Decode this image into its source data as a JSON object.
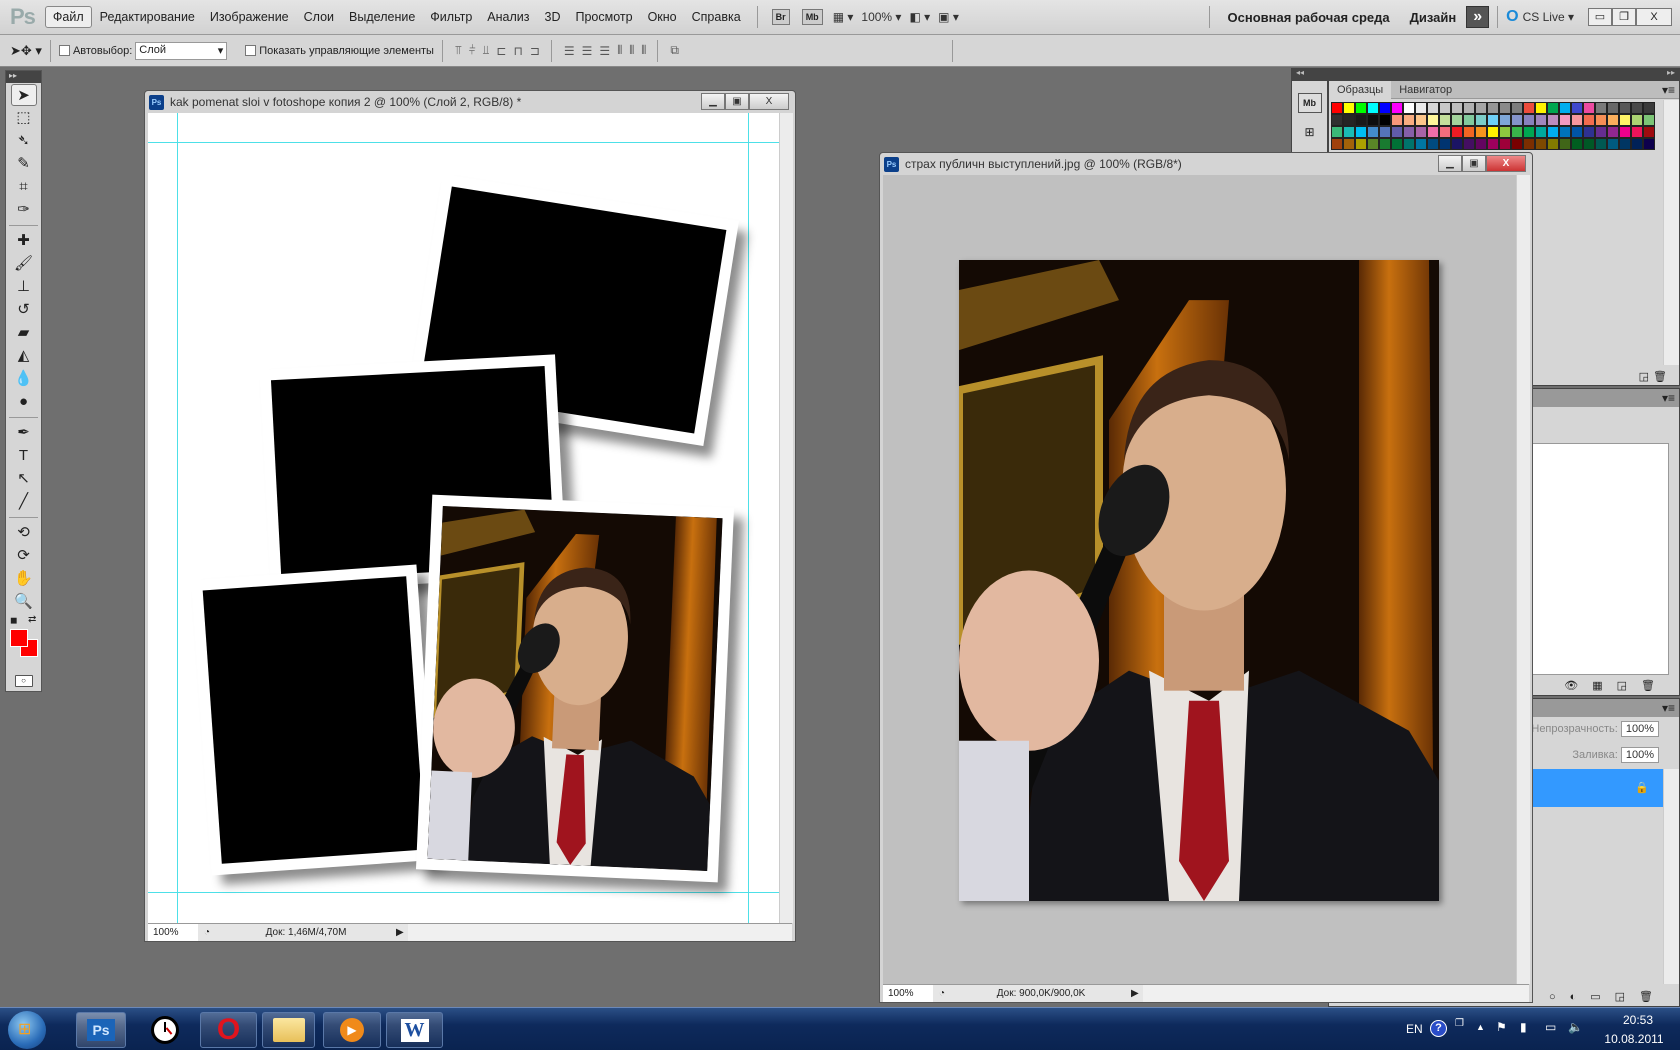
{
  "menubar": {
    "logo": "Ps",
    "items": [
      "Файл",
      "Редактирование",
      "Изображение",
      "Слои",
      "Выделение",
      "Фильтр",
      "Анализ",
      "3D",
      "Просмотр",
      "Окно",
      "Справка"
    ],
    "bridge": "Br",
    "minibridge": "Mb",
    "zoom": "100%",
    "workspace": "Основная рабочая среда",
    "design": "Дизайн",
    "more": "»",
    "cslive": "CS Live ▾",
    "win_min": "▭",
    "win_restore": "❐",
    "win_close": "X"
  },
  "options": {
    "auto_select_label": "Автовыбор:",
    "auto_select_value": "Слой",
    "show_controls_label": "Показать управляющие элементы"
  },
  "toolbar": {
    "tools": [
      {
        "name": "move-tool-icon",
        "glyph": "➤"
      },
      {
        "name": "marquee-tool-icon",
        "glyph": "⬚"
      },
      {
        "name": "lasso-tool-icon",
        "glyph": "➴"
      },
      {
        "name": "quick-select-tool-icon",
        "glyph": "✎"
      },
      {
        "name": "crop-tool-icon",
        "glyph": "⌗"
      },
      {
        "name": "eyedropper-tool-icon",
        "glyph": "✑"
      },
      {
        "sep": true
      },
      {
        "name": "healing-brush-icon",
        "glyph": "✚"
      },
      {
        "name": "brush-tool-icon",
        "glyph": "🖌"
      },
      {
        "name": "stamp-tool-icon",
        "glyph": "⊥"
      },
      {
        "name": "history-brush-icon",
        "glyph": "↺"
      },
      {
        "name": "eraser-tool-icon",
        "glyph": "▰"
      },
      {
        "name": "paint-bucket-icon",
        "glyph": "◭"
      },
      {
        "name": "blur-tool-icon",
        "glyph": "💧"
      },
      {
        "name": "dodge-tool-icon",
        "glyph": "●"
      },
      {
        "sep": true
      },
      {
        "name": "pen-tool-icon",
        "glyph": "✒"
      },
      {
        "name": "type-tool-icon",
        "glyph": "T"
      },
      {
        "name": "path-select-icon",
        "glyph": "↖"
      },
      {
        "name": "line-tool-icon",
        "glyph": "╱"
      },
      {
        "sep": true
      },
      {
        "name": "3d-rotate-icon",
        "glyph": "⟲"
      },
      {
        "name": "3d-orbit-icon",
        "glyph": "⟳"
      },
      {
        "name": "hand-tool-icon",
        "glyph": "✋"
      },
      {
        "name": "zoom-tool-icon",
        "glyph": "🔍"
      }
    ],
    "foreground": "#ff0000",
    "background": "#ff0000"
  },
  "doc1": {
    "title": "kak pomenat sloi v fotoshope копия 2 @ 100% (Слой 2, RGB/8) *",
    "zoom": "100%",
    "info": "Док: 1,46M/4,70M"
  },
  "doc2": {
    "title": "страх публичн выступлений.jpg @ 100% (RGB/8*)",
    "zoom": "100%",
    "info": "Док: 900,0K/900,0K"
  },
  "panels": {
    "dock_icon": "Mb",
    "tabs": [
      "Образцы",
      "Навигатор"
    ],
    "swatches": [
      [
        "#ff0000",
        "#ffff00",
        "#00ff00",
        "#00ffff",
        "#0000ff",
        "#ff00ff",
        "#ffffff",
        "#ebebeb",
        "#d7d7d7",
        "#c8c8c8",
        "#bdbdbd",
        "#b1b1b1",
        "#a5a5a5",
        "#969696",
        "#8a8a8a",
        "#7d7d7d",
        "#ed4c3c",
        "#fff200",
        "#00a650",
        "#00aeef",
        "#3f48cc",
        "#ec4ba0",
        "#7a7a7a",
        "#686868",
        "#585858",
        "#494949",
        "#3a3a3a"
      ],
      [
        "#303030",
        "#252525",
        "#1a1a1a",
        "#0e0e0e",
        "#000000",
        "#f7977a",
        "#f9ad81",
        "#fdc68a",
        "#fff79a",
        "#c4df9b",
        "#a3d39c",
        "#82ca9d",
        "#7bcdc8",
        "#6ecff6",
        "#7ea7d8",
        "#8493ca",
        "#8882be",
        "#a187be",
        "#bc8dbf",
        "#f49ac2",
        "#f6989d",
        "#f26c4f",
        "#f68e55",
        "#fbaf5c",
        "#fff467",
        "#acd372",
        "#7cc576"
      ],
      [
        "#3bb878",
        "#1abbb4",
        "#00bff3",
        "#438ccb",
        "#5574b9",
        "#605ca8",
        "#855fa8",
        "#a763a8",
        "#f06ea9",
        "#f26d7d",
        "#ed1c24",
        "#f26522",
        "#f7941d",
        "#fff200",
        "#8dc73f",
        "#39b54a",
        "#00a651",
        "#00a99d",
        "#00aeef",
        "#0072bc",
        "#0054a6",
        "#2e3192",
        "#662d91",
        "#92278f",
        "#ec008c",
        "#ed145b",
        "#9e0b0f"
      ],
      [
        "#a0410d",
        "#a36209",
        "#aba000",
        "#598527",
        "#197b30",
        "#007236",
        "#00746b",
        "#0076a3",
        "#004b80",
        "#003471",
        "#1b1464",
        "#440e62",
        "#630460",
        "#9e005d",
        "#9e0039",
        "#790000",
        "#7b2e00",
        "#7d4900",
        "#827b00",
        "#406618",
        "#005e20",
        "#005826",
        "#005952",
        "#005b7f",
        "#003663",
        "#002157",
        "#0d004c"
      ]
    ],
    "opacity_label": "Непрозрачность:",
    "opacity_value": "100%",
    "fill_label": "Заливка:",
    "fill_value": "100%",
    "selection_color": "#3399ff"
  },
  "taskbar": {
    "apps": [
      {
        "name": "photoshop",
        "label": "Ps"
      },
      {
        "name": "clock"
      },
      {
        "name": "opera",
        "label": "O"
      },
      {
        "name": "explorer"
      },
      {
        "name": "media-player",
        "label": "▶"
      },
      {
        "name": "word",
        "label": "W"
      }
    ],
    "lang": "EN",
    "help": "?",
    "time": "20:53",
    "date": "10.08.2011"
  }
}
